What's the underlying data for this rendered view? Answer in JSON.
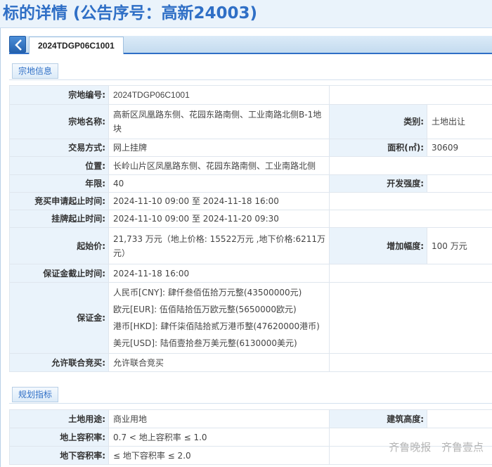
{
  "page": {
    "title": "标的详情 (公告序号：高新24003)"
  },
  "tabs": {
    "active": "2024TDGP06C1001"
  },
  "sections": {
    "land_info": "宗地信息",
    "planning": "规划指标"
  },
  "land": {
    "code_label": "宗地编号:",
    "code": "2024TDGP06C1001",
    "name_label": "宗地名称:",
    "name": "高新区凤凰路东侧、花园东路南侧、工业南路北侧B-1地块",
    "category_label": "类别:",
    "category": "土地出让",
    "trade_label": "交易方式:",
    "trade": "网上挂牌",
    "area_label": "面积(㎡):",
    "area": "30609",
    "location_label": "位置:",
    "location": "长岭山片区凤凰路东侧、花园东路南侧、工业南路北侧",
    "years_label": "年限:",
    "years": "40",
    "intensity_label": "开发强度:",
    "intensity": "",
    "bid_apply_label": "竞买申请起止时间:",
    "bid_apply": "2024-11-10 09:00 至 2024-11-18 16:00",
    "listing_label": "挂牌起止时间:",
    "listing": "2024-11-10 09:00 至 2024-11-20 09:30",
    "start_price_label": "起始价:",
    "start_price": "21,733 万元（地上价格: 15522万元 ,地下价格:6211万元）",
    "increment_label": "增加幅度:",
    "increment": "100 万元",
    "deposit_deadline_label": "保证金截止时间:",
    "deposit_deadline": "2024-11-18 16:00",
    "deposit_label": "保证金:",
    "deposit_lines": [
      "人民币[CNY]:  肆仟叁佰伍拾万元整(43500000元)",
      "欧元[EUR]:  伍佰陆拾伍万欧元整(5650000欧元)",
      "港币[HKD]:  肆仟柒佰陆拾贰万港币整(47620000港币)",
      "美元[USD]:  陆佰壹拾叁万美元整(6130000美元)"
    ],
    "joint_label": "允许联合竞买:",
    "joint": "允许联合竞买"
  },
  "planning": {
    "use_label": "土地用途:",
    "use": "商业用地",
    "height_label": "建筑高度:",
    "height": "",
    "far_above_label": "地上容积率:",
    "far_above": "0.7 < 地上容积率 ≤ 1.0",
    "far_below_label": "地下容积率:",
    "far_below": "≤ 地下容积率 ≤ 2.0"
  },
  "watermark": {
    "left": "齐鲁晚报",
    "right": "齐鲁壹点"
  }
}
